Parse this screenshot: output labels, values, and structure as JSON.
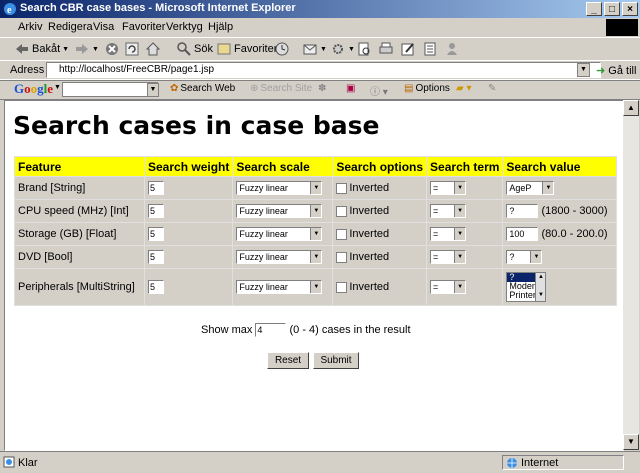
{
  "window": {
    "title": "Search CBR case bases - Microsoft Internet Explorer"
  },
  "menu": [
    "Arkiv",
    "Redigera",
    "Visa",
    "Favoriter",
    "Verktyg",
    "Hjälp"
  ],
  "toolbar": {
    "back": "Bakåt",
    "search": "Sök",
    "favorites": "Favoriter"
  },
  "address": {
    "label": "Adress",
    "url": "http://localhost/FreeCBR/page1.jsp",
    "go": "Gå till"
  },
  "google": {
    "logo": "Google",
    "search_web": "Search Web",
    "search_site": "Search Site",
    "options": "Options"
  },
  "page": {
    "heading": "Search cases in case base",
    "columns": [
      "Feature",
      "Search weight",
      "Search scale",
      "Search options",
      "Search term",
      "Search value"
    ],
    "rows": [
      {
        "feature": "Brand [String]",
        "weight": "5",
        "scale": "Fuzzy linear",
        "option": "Inverted",
        "term": "=",
        "value": "AgeP"
      },
      {
        "feature": "CPU speed (MHz) [Int]",
        "weight": "5",
        "scale": "Fuzzy linear",
        "option": "Inverted",
        "term": "=",
        "value": "?",
        "range": "(1800 - 3000)"
      },
      {
        "feature": "Storage (GB) [Float]",
        "weight": "5",
        "scale": "Fuzzy linear",
        "option": "Inverted",
        "term": "=",
        "value": "100",
        "range": "(80.0 - 200.0)"
      },
      {
        "feature": "DVD [Bool]",
        "weight": "5",
        "scale": "Fuzzy linear",
        "option": "Inverted",
        "term": "=",
        "value": "?"
      },
      {
        "feature": "Peripherals [MultiString]",
        "weight": "5",
        "scale": "Fuzzy linear",
        "option": "Inverted",
        "term": "=",
        "list": [
          "?",
          "Modem",
          "Printer"
        ]
      }
    ],
    "show_max": {
      "prefix": "Show max",
      "value": "4",
      "suffix": "(0 - 4) cases in the result"
    },
    "reset_label": "Reset",
    "submit_label": "Submit"
  },
  "status": {
    "text": "Klar",
    "zone": "Internet"
  },
  "colors": {
    "header_yellow": "#ffff00",
    "titlebar": "#0a246a"
  }
}
